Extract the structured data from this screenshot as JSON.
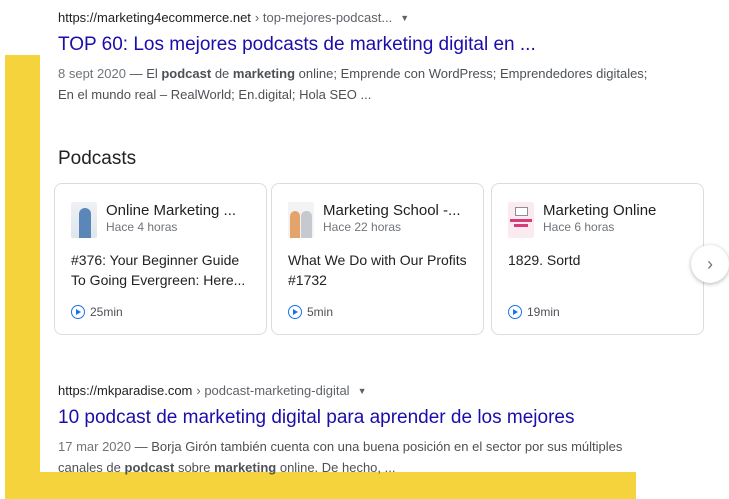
{
  "results": [
    {
      "domain": "https://marketing4ecommerce.net",
      "path": "› top-mejores-podcast...",
      "title": "TOP 60: Los mejores podcasts de marketing digital en ...",
      "date": "8 sept 2020",
      "snippet_parts": [
        "El ",
        "podcast",
        " de ",
        "marketing",
        " online; Emprende con WordPress; Emprendedores digitales; En el mundo real – RealWorld; En.digital; Hola SEO ..."
      ]
    },
    {
      "domain": "https://mkparadise.com",
      "path": "› podcast-marketing-digital",
      "title": "10 podcast de marketing digital para aprender de los mejores",
      "date": "17 mar 2020",
      "snippet_parts": [
        "Borja Girón también cuenta con una buena posición en el sector por sus múltiples canales de ",
        "podcast",
        " sobre ",
        "marketing",
        " online. De hecho, ..."
      ]
    }
  ],
  "podcasts": {
    "heading": "Podcasts",
    "cards": [
      {
        "show": "Online Marketing ...",
        "time": "Hace 4 horas",
        "episode": "#376: Your Beginner Guide To Going Evergreen: Here...",
        "duration": "25min",
        "thumb_icon": "podcast-cover-woman"
      },
      {
        "show": "Marketing School -...",
        "time": "Hace 22 horas",
        "episode": "What We Do with Our Profits #1732",
        "duration": "5min",
        "thumb_icon": "podcast-cover-two-men"
      },
      {
        "show": "Marketing Online",
        "time": "Hace 6 horas",
        "episode": "1829. Sortd",
        "duration": "19min",
        "thumb_icon": "podcast-cover-monitor"
      }
    ],
    "next_icon": "chevron-right-icon"
  },
  "colors": {
    "link": "#1a0dab",
    "accent": "#1a73e8",
    "frame": "#f5d33d"
  }
}
